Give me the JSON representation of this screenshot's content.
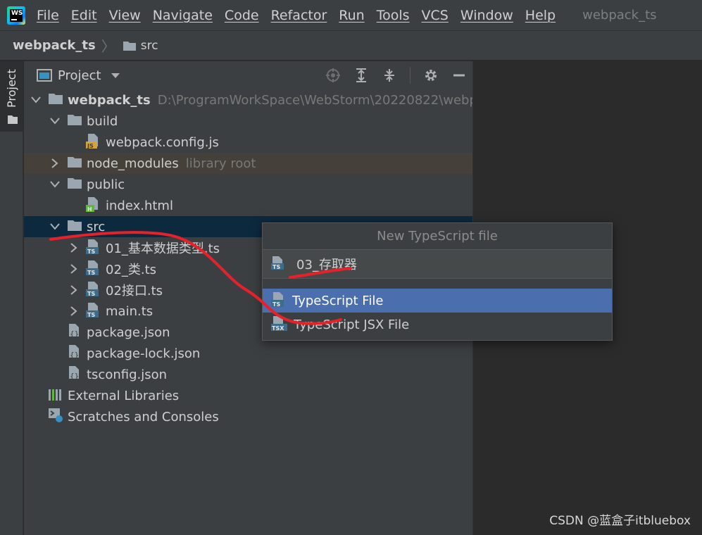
{
  "menubar": {
    "items": [
      "File",
      "Edit",
      "View",
      "Navigate",
      "Code",
      "Refactor",
      "Run",
      "Tools",
      "VCS",
      "Window",
      "Help"
    ],
    "window_title": "webpack_ts"
  },
  "breadcrumb": {
    "root": "webpack_ts",
    "child": "src"
  },
  "toolstrip": {
    "project_label": "Project"
  },
  "project_panel": {
    "title": "Project",
    "tree": [
      {
        "label": "webpack_ts",
        "hint": "D:\\ProgramWorkSpace\\WebStorm\\20220822\\webpac",
        "icon": "folder-icon",
        "depth": 0,
        "expanded": true,
        "bold": true
      },
      {
        "label": "build",
        "icon": "folder-icon",
        "depth": 1,
        "expanded": true
      },
      {
        "label": "webpack.config.js",
        "icon": "js-file-icon",
        "depth": 2
      },
      {
        "label": "node_modules",
        "hint": "library root",
        "icon": "folder-icon",
        "depth": 1,
        "expanded": false,
        "excluded": true
      },
      {
        "label": "public",
        "icon": "folder-icon",
        "depth": 1,
        "expanded": true
      },
      {
        "label": "index.html",
        "icon": "html-file-icon",
        "depth": 2
      },
      {
        "label": "src",
        "icon": "folder-icon",
        "depth": 1,
        "expanded": true,
        "selected": true
      },
      {
        "label": "01_基本数据类型.ts",
        "icon": "ts-file-icon",
        "depth": 2,
        "expanded": false
      },
      {
        "label": "02_类.ts",
        "icon": "ts-file-icon",
        "depth": 2,
        "expanded": false
      },
      {
        "label": "02接口.ts",
        "icon": "ts-file-icon",
        "depth": 2,
        "expanded": false
      },
      {
        "label": "main.ts",
        "icon": "ts-file-icon",
        "depth": 2,
        "expanded": false
      },
      {
        "label": "package.json",
        "icon": "json-file-icon",
        "depth": 1
      },
      {
        "label": "package-lock.json",
        "icon": "json-file-icon",
        "depth": 1
      },
      {
        "label": "tsconfig.json",
        "icon": "json-file-icon",
        "depth": 1
      },
      {
        "label": "External Libraries",
        "icon": "library-icon",
        "depth": 0
      },
      {
        "label": "Scratches and Consoles",
        "icon": "scratches-icon",
        "depth": 0
      }
    ]
  },
  "popup": {
    "title": "New TypeScript file",
    "input_value": "03_存取器",
    "items": [
      {
        "label": "TypeScript File",
        "icon": "ts-file-icon",
        "active": true
      },
      {
        "label": "TypeScript JSX File",
        "icon": "tsx-file-icon",
        "active": false
      }
    ]
  },
  "watermark": "CSDN @蓝盒子itbluebox",
  "colors": {
    "menubar_bg": "#3c3f41",
    "selection_bg": "#0d293e",
    "popup_active_bg": "#4b6eaf",
    "annotation_red": "#e8202a"
  }
}
